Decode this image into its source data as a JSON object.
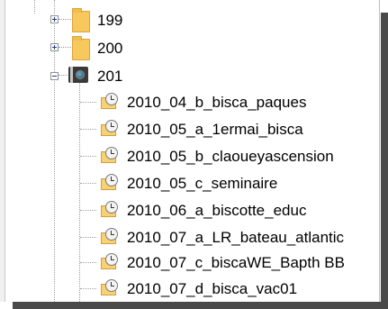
{
  "tree": {
    "folders": [
      {
        "label": "199",
        "state": "collapsed",
        "icon": "folder-icon"
      },
      {
        "label": "200",
        "state": "collapsed",
        "icon": "folder-icon"
      },
      {
        "label": "201",
        "state": "expanded",
        "icon": "camera-folder-icon"
      }
    ],
    "children": [
      {
        "label": "2010_04_b_bisca_paques",
        "icon": "clock-folder-icon"
      },
      {
        "label": "2010_05_a_1ermai_bisca",
        "icon": "clock-folder-icon"
      },
      {
        "label": "2010_05_b_claoueyascension",
        "icon": "clock-folder-icon"
      },
      {
        "label": "2010_05_c_seminaire",
        "icon": "clock-folder-icon"
      },
      {
        "label": "2010_06_a_biscotte_educ",
        "icon": "clock-folder-icon"
      },
      {
        "label": "2010_07_a_LR_bateau_atlantic",
        "icon": "clock-folder-icon"
      },
      {
        "label": "2010_07_c_biscaWE_Bapth BB",
        "icon": "clock-folder-icon"
      },
      {
        "label": "2010_07_d_bisca_vac01",
        "icon": "clock-folder-icon"
      }
    ]
  },
  "colors": {
    "folder": "#f7c85c",
    "tree_line": "#a0a0a0",
    "shadow": "#4a4a4a",
    "expander_sign": "#1b3c8c"
  }
}
